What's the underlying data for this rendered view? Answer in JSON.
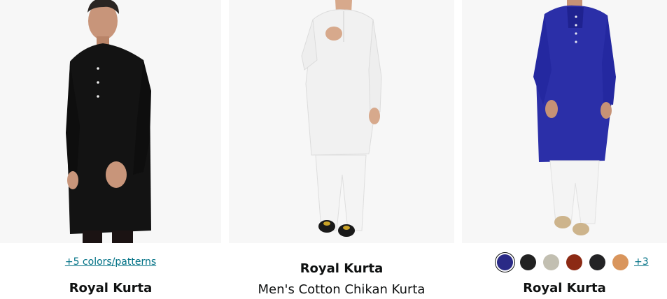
{
  "products": [
    {
      "colors_link": "+5 colors/patterns",
      "brand": "Royal Kurta",
      "image": "black-kurta-photo"
    },
    {
      "brand": "Royal Kurta",
      "title": "Men's Cotton Chikan Kurta",
      "image": "white-kurta-photo"
    },
    {
      "brand": "Royal Kurta",
      "image": "blue-kurta-photo",
      "swatches": [
        "#2a2a86",
        "#222222",
        "#c2bfb1",
        "#8c2a14",
        "#232325",
        "#d9955c"
      ],
      "selected_swatch_index": 0,
      "more_colors": "+3"
    }
  ],
  "colors": {
    "link": "#007185",
    "text": "#0f1111",
    "image_bg": "#f7f7f7"
  }
}
